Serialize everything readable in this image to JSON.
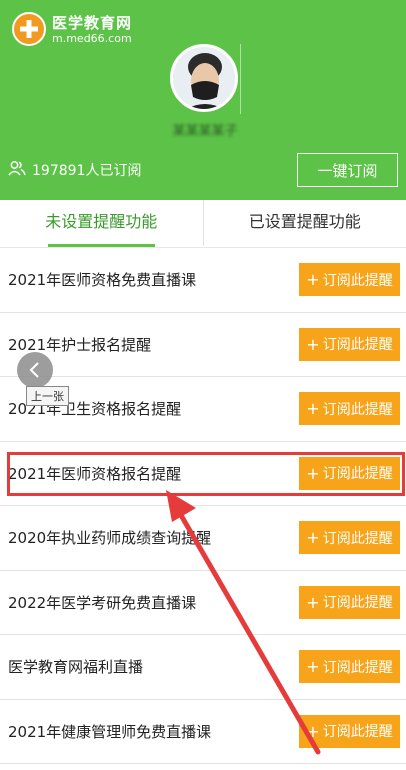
{
  "header": {
    "logo_cn": "医学教育网",
    "logo_url": "m.med66.com",
    "username": "某某某某子",
    "subscribers": "197891人已订阅",
    "one_click_label": "一键订阅",
    "bg_color": "#5cc348"
  },
  "tabs": [
    {
      "label": "未设置提醒功能",
      "active": true
    },
    {
      "label": "已设置提醒功能",
      "active": false
    }
  ],
  "list": {
    "button_label": "订阅此提醒",
    "button_color": "#f7a41a",
    "items": [
      {
        "title": "2021年医师资格免费直播课"
      },
      {
        "title": "2021年护士报名提醒"
      },
      {
        "title": "2021年卫生资格报名提醒"
      },
      {
        "title": "2021年医师资格报名提醒"
      },
      {
        "title": "2020年执业药师成绩查询提醒"
      },
      {
        "title": "2022年医学考研免费直播课"
      },
      {
        "title": "医学教育网福利直播"
      },
      {
        "title": "2021年健康管理师免费直播课"
      }
    ]
  },
  "overlay": {
    "prev_tooltip": "上一张",
    "highlight_color": "#e53b3b"
  }
}
